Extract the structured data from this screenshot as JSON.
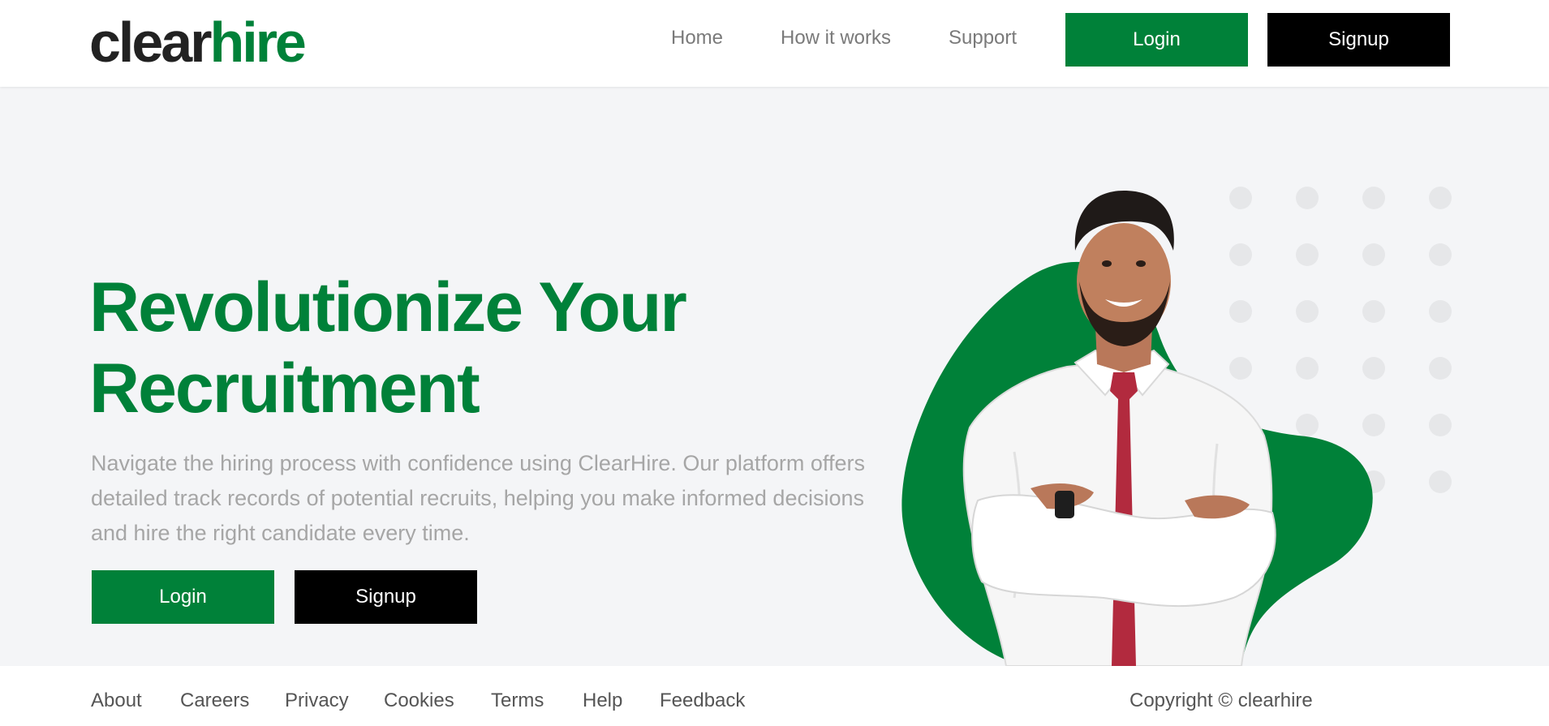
{
  "brand": {
    "logo_part1": "clear",
    "logo_part2": "hire",
    "accent_color": "#008139",
    "dark_color": "#000000"
  },
  "header": {
    "nav": [
      {
        "label": "Home"
      },
      {
        "label": "How it works"
      },
      {
        "label": "Support"
      }
    ],
    "login_label": "Login",
    "signup_label": "Signup"
  },
  "hero": {
    "title_line1": "Revolutionize Your",
    "title_line2": "Recruitment",
    "description": "Navigate the hiring process with confidence using ClearHire. Our platform offers detailed track records of potential recruits, helping you make informed decisions and hire the right candidate every time.",
    "login_label": "Login",
    "signup_label": "Signup",
    "image_subject": "smiling-man-white-shirt-red-tie-arms-crossed"
  },
  "footer": {
    "links": [
      {
        "label": "About"
      },
      {
        "label": "Careers"
      },
      {
        "label": "Privacy"
      },
      {
        "label": "Cookies"
      },
      {
        "label": "Terms"
      },
      {
        "label": "Help"
      },
      {
        "label": "Feedback"
      }
    ],
    "copyright": "Copyright © clearhire"
  }
}
